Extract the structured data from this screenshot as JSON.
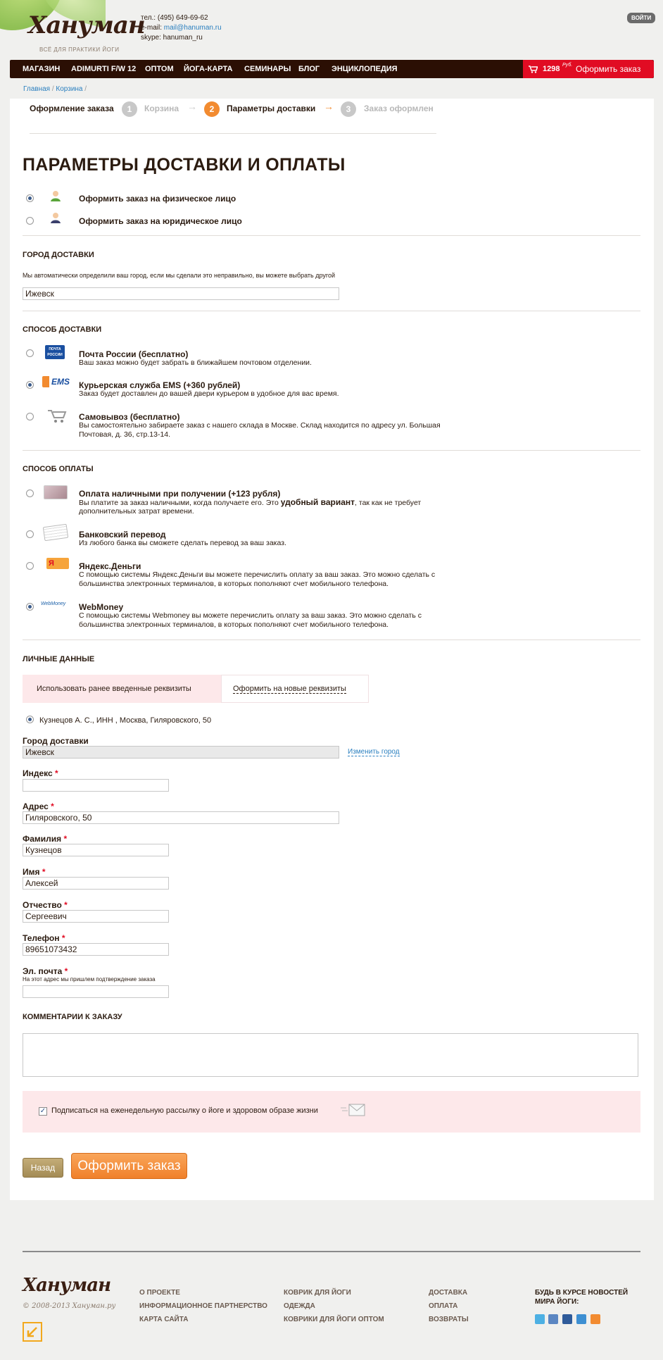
{
  "header": {
    "logo": "Хануман",
    "logo_sub": "ВСЁ ДЛЯ ПРАКТИКИ ЙОГИ",
    "phone": "тел.: (495) 649-69-62",
    "email_label": "e-mail:",
    "email": "mail@hanuman.ru",
    "skype": "skype: hanuman_ru",
    "login": "ВОЙТИ"
  },
  "nav": {
    "items": [
      "МАГАЗИН",
      "ADIMURTI F/W 12",
      "ОПТОМ",
      "ЙОГА-КАРТА",
      "СЕМИНАРЫ",
      "БЛОГ",
      "ЭНЦИКЛОПЕДИЯ"
    ],
    "cart_amount": "1298",
    "cart_currency": "Руб.",
    "cart_checkout": "Оформить заказ"
  },
  "breadcrumb": [
    "Главная",
    "Корзина"
  ],
  "steps": {
    "title": "Оформление заказа",
    "items": [
      {
        "num": "1",
        "label": "Корзина"
      },
      {
        "num": "2",
        "label": "Параметры доставки"
      },
      {
        "num": "3",
        "label": "Заказ оформлен"
      }
    ]
  },
  "page_title": "ПАРАМЕТРЫ ДОСТАВКИ И ОПЛАТЫ",
  "person_type": {
    "individual": "Оформить заказ на физическое лицо",
    "legal": "Оформить заказ на юридическое лицо"
  },
  "city": {
    "heading": "ГОРОД ДОСТАВКИ",
    "hint": "Мы автоматически определили ваш город, если мы сделали это неправильно, вы можете выбрать другой",
    "value": "Ижевск"
  },
  "delivery": {
    "heading": "СПОСОБ ДОСТАВКИ",
    "options": [
      {
        "title": "Почта России (бесплатно)",
        "desc": "Ваш заказ можно будет забрать в ближайшем почтовом отделении.",
        "icon": "russian-post-icon",
        "icon_text": "ПОЧТА РОССИИ"
      },
      {
        "title": "Курьерская служба EMS (+360 рублей)",
        "desc": "Заказ будет доставлен до вашей двери курьером в удобное для вас время.",
        "icon": "ems-icon",
        "icon_text": "EMS"
      },
      {
        "title": "Самовывоз (бесплатно)",
        "desc": "Вы самостоятельно забираете заказ с нашего склада в Москве. Склад находится по адресу ул. Большая",
        "desc2": "Почтовая, д. 36, стр.13-14.",
        "icon": "cart-icon"
      }
    ]
  },
  "payment": {
    "heading": "СПОСОБ ОПЛАТЫ",
    "options": [
      {
        "title": "Оплата наличными при получении (+123 рубля)",
        "desc_a": "Вы платите за заказ наличными, когда получаете его. Это ",
        "desc_bold": "удобный вариант",
        "desc_b": ", так как не требует",
        "desc2": "дополнительных затрат времени.",
        "icon": "cash-icon"
      },
      {
        "title": "Банковский перевод",
        "desc": "Из любого банка вы сможете сделать перевод за ваш заказ.",
        "icon": "bank-icon"
      },
      {
        "title": "Яндекс.Деньги",
        "desc": "С помощью системы Яндекс.Деньги вы можете перечислить оплату за ваш заказ. Это можно сделать с",
        "desc2": "большинства электронных терминалов, в которых пополняют счет мобильного телефона.",
        "icon": "yandex-money-icon",
        "icon_text": "Я"
      },
      {
        "title": "WebMoney",
        "desc": "С помощью системы Webmoney вы можете перечислить оплату за ваш заказ. Это можно сделать с",
        "desc2": "большинства электронных терминалов, в которых пополняют счет мобильного телефона.",
        "icon": "webmoney-icon",
        "icon_text": "WebMoney"
      }
    ]
  },
  "personal": {
    "heading": "ЛИЧНЫЕ ДАННЫЕ",
    "tab_saved": "Использовать ранее введенные реквизиты",
    "tab_new": "Оформить на новые реквизиты",
    "saved_record": "Кузнецов А. С., ИНН , Москва, Гиляровского, 50",
    "city_label": "Город доставки",
    "city_value": "Ижевск",
    "change_city": "Изменить город",
    "index_label": "Индекс",
    "index_value": "",
    "address_label": "Адрес",
    "address_value": "Гиляровского, 50",
    "surname_label": "Фамилия",
    "surname_value": "Кузнецов",
    "name_label": "Имя",
    "name_value": "Алексей",
    "patronymic_label": "Отчество",
    "patronymic_value": "Сергеевич",
    "phone_label": "Телефон",
    "phone_value": "89651073432",
    "email_label": "Эл. почта",
    "email_hint": "На этот адрес мы пришлем подтверждение заказа",
    "email_value": "",
    "required_mark": "*"
  },
  "comments": {
    "heading": "КОММЕНТАРИИ К ЗАКАЗУ",
    "value": ""
  },
  "subscribe": {
    "label": "Подписаться на еженедельную рассылку о йоге и здоровом образе жизни"
  },
  "buttons": {
    "back": "Назад",
    "order": "Оформить заказ"
  },
  "footer": {
    "logo": "Хануман",
    "copyright": "© 2008-2013 Хануман.ру",
    "col1": [
      "О ПРОЕКТЕ",
      "ИНФОРМАЦИОННОЕ ПАРТНЕРСТВО",
      "КАРТА САЙТА"
    ],
    "col2": [
      "КОВРИК ДЛЯ ЙОГИ",
      "ОДЕЖДА",
      "КОВРИКИ ДЛЯ ЙОГИ ОПТОМ"
    ],
    "col3": [
      "ДОСТАВКА",
      "ОПЛАТА",
      "ВОЗВРАТЫ"
    ],
    "news_title_1": "БУДЬ В КУРСЕ НОВОСТЕЙ",
    "news_title_2": "МИРА ЙОГИ:"
  },
  "colors": {
    "accent_red": "#e10c23",
    "accent_orange": "#f28b30",
    "nav_bg": "#2b0f04",
    "link_blue": "#2a7fbf"
  }
}
